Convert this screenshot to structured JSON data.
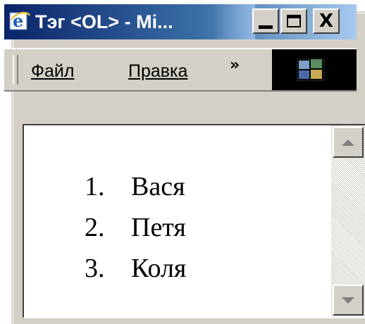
{
  "window": {
    "title": "Тэг <OL> - Mi...",
    "icon": "internet-explorer-icon"
  },
  "titlebar_buttons": {
    "minimize_icon": "minimize-icon",
    "maximize_icon": "maximize-icon",
    "close_glyph": "X"
  },
  "menubar": {
    "file_label": "Файл",
    "edit_label": "Правка",
    "overflow_chevron": "»",
    "throbber_icon": "windows-logo-icon"
  },
  "document": {
    "list_items": [
      {
        "number": "1.",
        "text": "Вася"
      },
      {
        "number": "2.",
        "text": "Петя"
      },
      {
        "number": "3.",
        "text": "Коля"
      }
    ]
  },
  "scrollbar": {
    "up_icon": "scroll-up-icon",
    "down_icon": "scroll-down-icon"
  },
  "colors": {
    "titlebar_start": "#0a246a",
    "titlebar_end": "#a6caf0",
    "chrome": "#d4d0c8"
  }
}
